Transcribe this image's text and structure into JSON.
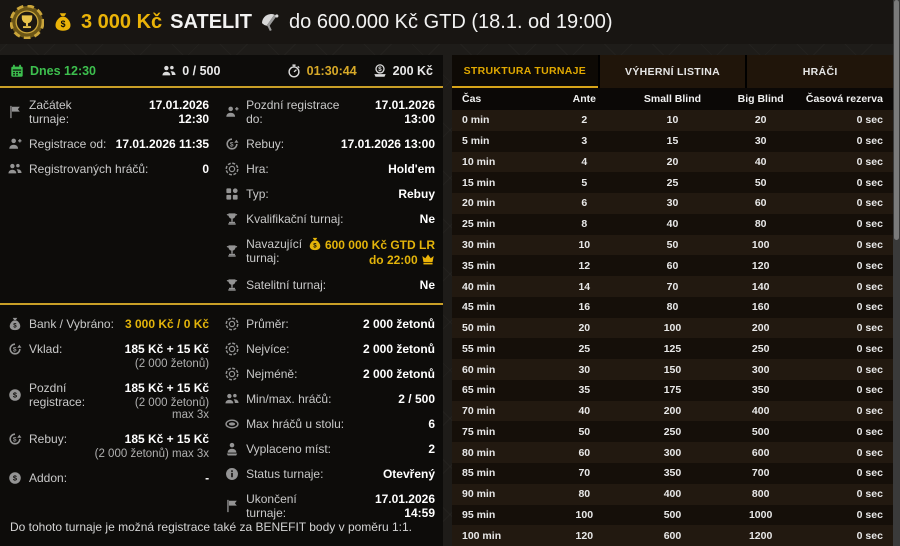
{
  "header": {
    "prize": "3 000 Kč",
    "name": "SATELIT",
    "rest": "do 600.000 Kč GTD (18.1. od 19:00)"
  },
  "topbar": {
    "date": "Dnes 12:30",
    "players": "0 / 500",
    "timer": "01:30:44",
    "fee": "200 Kč"
  },
  "tournament_info": {
    "start": {
      "label": "Začátek turnaje:",
      "value": "17.01.2026 12:30"
    },
    "reg_from": {
      "label": "Registrace od:",
      "value": "17.01.2026 11:35"
    },
    "reg_players": {
      "label": "Registrovaných hráčů:",
      "value": "0"
    },
    "late_reg_until": {
      "label": "Pozdní registrace do:",
      "value": "17.01.2026 13:00"
    },
    "rebuy_until": {
      "label": "Rebuy:",
      "value": "17.01.2026 13:00"
    },
    "game": {
      "label": "Hra:",
      "value": "Hold'em"
    },
    "type": {
      "label": "Typ:",
      "value": "Rebuy"
    },
    "qualifier": {
      "label": "Kvalifikační turnaj:",
      "value": "Ne"
    },
    "followup": {
      "label": "Navazující turnaj:",
      "value": "600 000 Kč GTD LR do 22:00"
    },
    "satellite": {
      "label": "Satelitní turnaj:",
      "value": "Ne"
    }
  },
  "bank_info": {
    "bank": {
      "label": "Bank / Vybráno:",
      "value": "3 000 Kč / 0 Kč"
    },
    "buyin": {
      "label": "Vklad:",
      "value": "185 Kč + 15 Kč",
      "sub": "(2 000 žetonů)"
    },
    "late_reg": {
      "label": "Pozdní registrace:",
      "value": "185 Kč + 15 Kč",
      "sub": "(2 000 žetonů) max 3x"
    },
    "rebuy": {
      "label": "Rebuy:",
      "value": "185 Kč + 15 Kč",
      "sub": "(2 000 žetonů) max 3x"
    },
    "addon": {
      "label": "Addon:",
      "value": "-"
    }
  },
  "stats": {
    "avg": {
      "label": "Průměr:",
      "value": "2 000 žetonů"
    },
    "max": {
      "label": "Nejvíce:",
      "value": "2 000 žetonů"
    },
    "min": {
      "label": "Nejméně:",
      "value": "2 000 žetonů"
    },
    "minmax_players": {
      "label": "Min/max. hráčů:",
      "value": "2 / 500"
    },
    "table_max": {
      "label": "Max hráčů u stolu:",
      "value": "6"
    },
    "paid_places": {
      "label": "Vyplaceno míst:",
      "value": "2"
    },
    "status": {
      "label": "Status turnaje:",
      "value": "Otevřený"
    },
    "end": {
      "label": "Ukončení turnaje:",
      "value": "17.01.2026 14:59"
    }
  },
  "footer_note": "Do tohoto turnaje je možná registrace také za BENEFIT body v poměru 1:1.",
  "tabs": [
    {
      "label": "STRUKTURA TURNAJE",
      "active": true
    },
    {
      "label": "VÝHERNÍ LISTINA",
      "active": false
    },
    {
      "label": "HRÁČI",
      "active": false
    }
  ],
  "structure_table": {
    "columns": [
      "Čas",
      "Ante",
      "Small Blind",
      "Big Blind",
      "Časová rezerva"
    ],
    "rows": [
      [
        "0 min",
        "2",
        "10",
        "20",
        "0 sec"
      ],
      [
        "5 min",
        "3",
        "15",
        "30",
        "0 sec"
      ],
      [
        "10 min",
        "4",
        "20",
        "40",
        "0 sec"
      ],
      [
        "15 min",
        "5",
        "25",
        "50",
        "0 sec"
      ],
      [
        "20 min",
        "6",
        "30",
        "60",
        "0 sec"
      ],
      [
        "25 min",
        "8",
        "40",
        "80",
        "0 sec"
      ],
      [
        "30 min",
        "10",
        "50",
        "100",
        "0 sec"
      ],
      [
        "35 min",
        "12",
        "60",
        "120",
        "0 sec"
      ],
      [
        "40 min",
        "14",
        "70",
        "140",
        "0 sec"
      ],
      [
        "45 min",
        "16",
        "80",
        "160",
        "0 sec"
      ],
      [
        "50 min",
        "20",
        "100",
        "200",
        "0 sec"
      ],
      [
        "55 min",
        "25",
        "125",
        "250",
        "0 sec"
      ],
      [
        "60 min",
        "30",
        "150",
        "300",
        "0 sec"
      ],
      [
        "65 min",
        "35",
        "175",
        "350",
        "0 sec"
      ],
      [
        "70 min",
        "40",
        "200",
        "400",
        "0 sec"
      ],
      [
        "75 min",
        "50",
        "250",
        "500",
        "0 sec"
      ],
      [
        "80 min",
        "60",
        "300",
        "600",
        "0 sec"
      ],
      [
        "85 min",
        "70",
        "350",
        "700",
        "0 sec"
      ],
      [
        "90 min",
        "80",
        "400",
        "800",
        "0 sec"
      ],
      [
        "95 min",
        "100",
        "500",
        "1000",
        "0 sec"
      ],
      [
        "100 min",
        "120",
        "600",
        "1200",
        "0 sec"
      ]
    ]
  },
  "colors": {
    "accent_gold": "#e3b40a",
    "divider_gold": "#c99f27",
    "green": "#3dbf4e"
  }
}
